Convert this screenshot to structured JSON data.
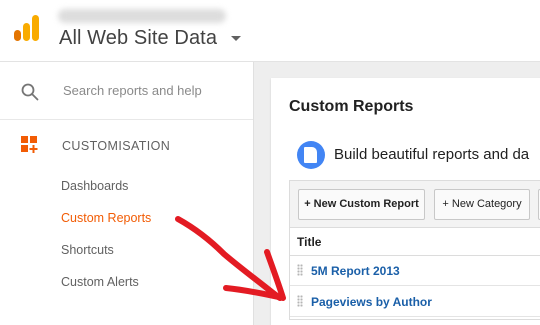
{
  "header": {
    "property_title": "All Web Site Data"
  },
  "sidebar": {
    "search_placeholder": "Search reports and help",
    "section_label": "CUSTOMISATION",
    "items": [
      {
        "label": "Dashboards",
        "active": false
      },
      {
        "label": "Custom Reports",
        "active": true
      },
      {
        "label": "Shortcuts",
        "active": false
      },
      {
        "label": "Custom Alerts",
        "active": false
      }
    ]
  },
  "main": {
    "title": "Custom Reports",
    "promo_text": "Build beautiful reports and da",
    "toolbar": {
      "new_report_label": "+ New Custom Report",
      "new_category_label": "+ New Category"
    },
    "table": {
      "column_title": "Title",
      "rows": [
        {
          "title": "5M Report 2013"
        },
        {
          "title": "Pageviews by Author"
        }
      ]
    }
  },
  "colors": {
    "accent_orange": "#f25c05",
    "link_blue": "#1a5fa8",
    "annotation_red": "#e31b23"
  }
}
